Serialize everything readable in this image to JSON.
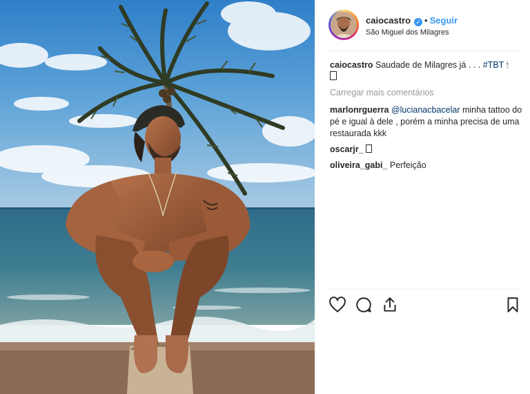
{
  "post": {
    "username": "caiocastro",
    "follow_label": "Seguir",
    "location": "São Miguel dos Milagres",
    "separator": "•"
  },
  "caption": {
    "user": "caiocastro",
    "text": "Saudade de Milagres já . . .",
    "hashtag": "#TBT",
    "emoji": "🕯"
  },
  "load_more_label": "Carregar mais comentários",
  "comments": [
    {
      "user": "marlonrguerra",
      "mention": "@lucianacbacelar",
      "text": "minha tattoo do pé e igual à dele , porém a minha precisa de uma restaurada kkk"
    },
    {
      "user": "oscarjr_",
      "text": ""
    },
    {
      "user": "oliveira_gabi_",
      "text": "Perfeição"
    }
  ],
  "icons": {
    "like": "heart-icon",
    "comment": "comment-icon",
    "share": "share-icon",
    "save": "bookmark-icon",
    "verified": "verified-badge-icon"
  },
  "colors": {
    "link_blue": "#3897f0",
    "hashtag": "#003569",
    "muted": "#999999",
    "text": "#262626"
  }
}
